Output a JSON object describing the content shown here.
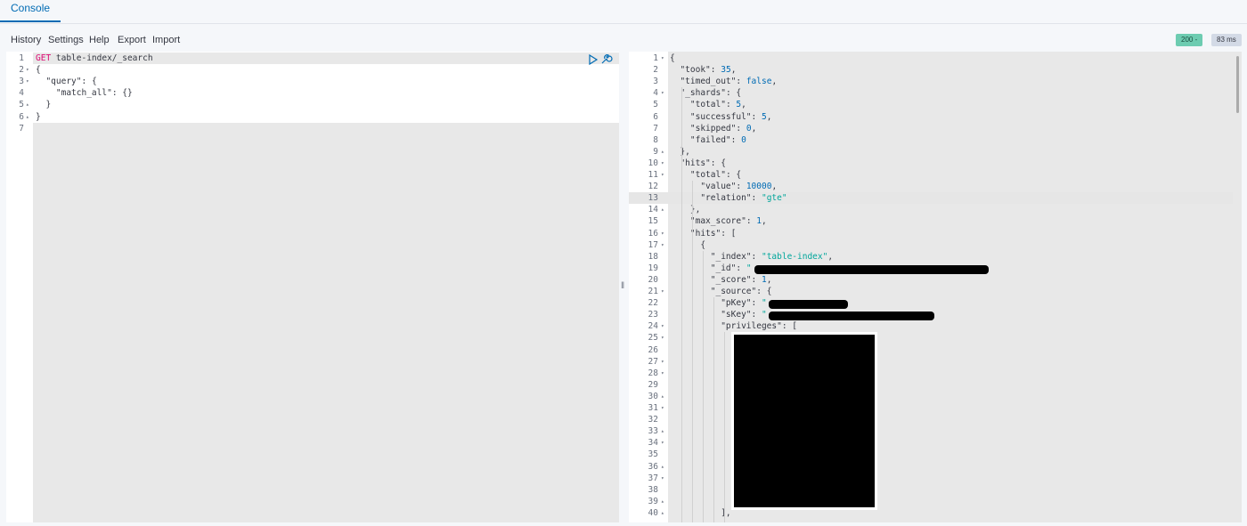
{
  "tabs": [
    {
      "label": "Console"
    }
  ],
  "menu": {
    "history": "History",
    "settings": "Settings",
    "help": "Help",
    "export": "Export",
    "import": "Import"
  },
  "status": {
    "code": "200 -",
    "time": "83 ms"
  },
  "request": {
    "lines": [
      {
        "n": "1",
        "fold": "",
        "text": "GET table-index/_search"
      },
      {
        "n": "2",
        "fold": "▾",
        "text": "{"
      },
      {
        "n": "3",
        "fold": "▾",
        "text": "  \"query\": {"
      },
      {
        "n": "4",
        "fold": "",
        "text": "    \"match_all\": {}"
      },
      {
        "n": "5",
        "fold": "▴",
        "text": "  }"
      },
      {
        "n": "6",
        "fold": "▴",
        "text": "}"
      },
      {
        "n": "7",
        "fold": "",
        "text": ""
      }
    ]
  },
  "response": {
    "lines": [
      {
        "n": "1",
        "fold": "▾",
        "text": "{"
      },
      {
        "n": "2",
        "fold": "",
        "text": "  \"took\": 35,"
      },
      {
        "n": "3",
        "fold": "",
        "text": "  \"timed_out\": false,"
      },
      {
        "n": "4",
        "fold": "▾",
        "text": "  \"_shards\": {"
      },
      {
        "n": "5",
        "fold": "",
        "text": "    \"total\": 5,"
      },
      {
        "n": "6",
        "fold": "",
        "text": "    \"successful\": 5,"
      },
      {
        "n": "7",
        "fold": "",
        "text": "    \"skipped\": 0,"
      },
      {
        "n": "8",
        "fold": "",
        "text": "    \"failed\": 0"
      },
      {
        "n": "9",
        "fold": "▴",
        "text": "  },"
      },
      {
        "n": "10",
        "fold": "▾",
        "text": "  \"hits\": {"
      },
      {
        "n": "11",
        "fold": "▾",
        "text": "    \"total\": {"
      },
      {
        "n": "12",
        "fold": "",
        "text": "      \"value\": 10000,"
      },
      {
        "n": "13",
        "fold": "",
        "text": "      \"relation\": \"gte\""
      },
      {
        "n": "14",
        "fold": "▴",
        "text": "    },"
      },
      {
        "n": "15",
        "fold": "",
        "text": "    \"max_score\": 1,"
      },
      {
        "n": "16",
        "fold": "▾",
        "text": "    \"hits\": ["
      },
      {
        "n": "17",
        "fold": "▾",
        "text": "      {"
      },
      {
        "n": "18",
        "fold": "",
        "text": "        \"_index\": \"table-index\","
      },
      {
        "n": "19",
        "fold": "",
        "text": "        \"_id\": \""
      },
      {
        "n": "20",
        "fold": "",
        "text": "        \"_score\": 1,"
      },
      {
        "n": "21",
        "fold": "▾",
        "text": "        \"_source\": {"
      },
      {
        "n": "22",
        "fold": "",
        "text": "          \"pKey\": \""
      },
      {
        "n": "23",
        "fold": "",
        "text": "          \"sKey\": \""
      },
      {
        "n": "24",
        "fold": "▾",
        "text": "          \"privileges\": ["
      },
      {
        "n": "25",
        "fold": "▾",
        "text": ""
      },
      {
        "n": "26",
        "fold": "",
        "text": ""
      },
      {
        "n": "27",
        "fold": "▾",
        "text": ""
      },
      {
        "n": "28",
        "fold": "▾",
        "text": ""
      },
      {
        "n": "29",
        "fold": "",
        "text": ""
      },
      {
        "n": "30",
        "fold": "▴",
        "text": ""
      },
      {
        "n": "31",
        "fold": "▾",
        "text": ""
      },
      {
        "n": "32",
        "fold": "",
        "text": ""
      },
      {
        "n": "33",
        "fold": "▴",
        "text": ""
      },
      {
        "n": "34",
        "fold": "▾",
        "text": ""
      },
      {
        "n": "35",
        "fold": "",
        "text": ""
      },
      {
        "n": "36",
        "fold": "▴",
        "text": ""
      },
      {
        "n": "37",
        "fold": "▾",
        "text": ""
      },
      {
        "n": "38",
        "fold": "",
        "text": ""
      },
      {
        "n": "39",
        "fold": "▴",
        "text": ""
      },
      {
        "n": "40",
        "fold": "▴",
        "text": "          ],"
      }
    ]
  },
  "icons": {
    "play": "play-icon",
    "wrench": "wrench-icon",
    "drag": "drag-handle-icon"
  }
}
